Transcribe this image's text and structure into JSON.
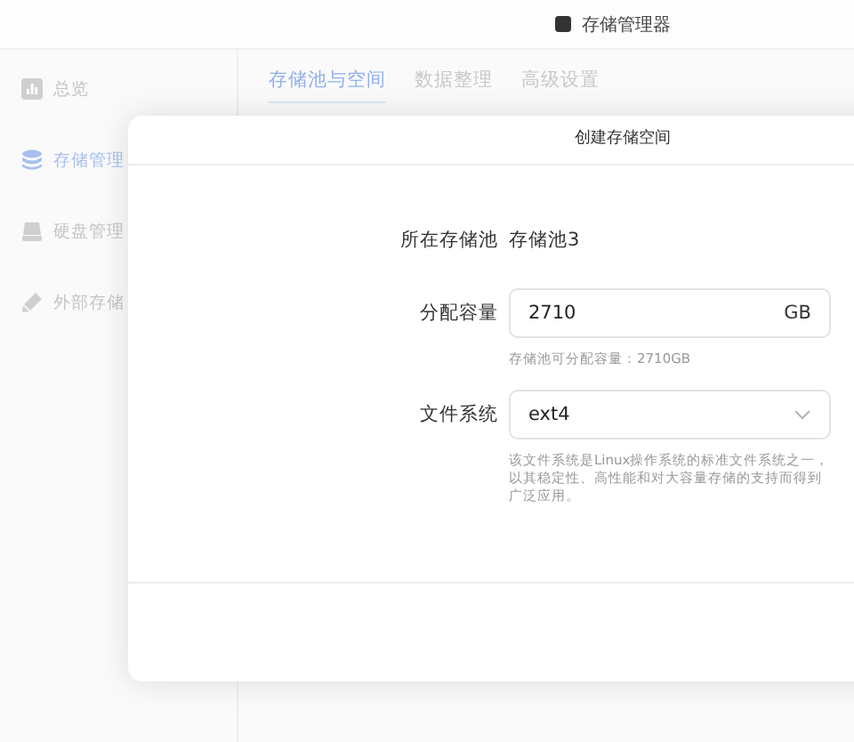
{
  "window": {
    "title": "存储管理器"
  },
  "sidebar": {
    "items": [
      {
        "label": "总览",
        "selected": false
      },
      {
        "label": "存储管理",
        "selected": true
      },
      {
        "label": "硬盘管理",
        "selected": false
      },
      {
        "label": "外部存储",
        "selected": false
      }
    ]
  },
  "tabs": [
    {
      "label": "存储池与空间",
      "selected": true
    },
    {
      "label": "数据整理",
      "selected": false
    },
    {
      "label": "高级设置",
      "selected": false
    }
  ],
  "dialog": {
    "title": "创建存储空间",
    "fields": [
      {
        "kind": "static",
        "label": "所在存储池",
        "value": "存储池3"
      },
      {
        "kind": "input",
        "label": "分配容量",
        "value": "2710",
        "unit": "GB",
        "hint": "存储池可分配容量：2710GB"
      },
      {
        "kind": "select",
        "label": "文件系统",
        "value": "ext4",
        "hint": "该文件系统是Linux操作系统的标准文件系统之一，以其稳定性、高性能和对大容量存储的支持而得到广泛应用。"
      }
    ]
  }
}
